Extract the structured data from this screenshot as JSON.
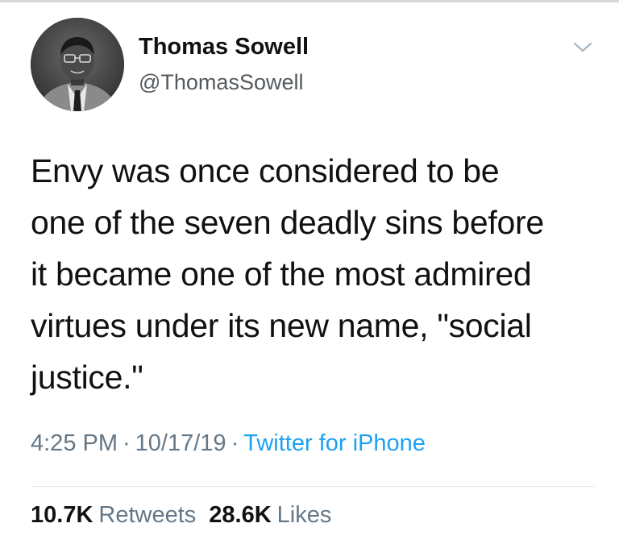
{
  "user": {
    "display_name": "Thomas Sowell",
    "handle": "@ThomasSowell",
    "avatar_icon": "profile-photo"
  },
  "tweet": {
    "text": "Envy was once considered to be\none of the seven deadly sins before\nit became one of the most admired\nvirtues under its new name, \"social\njustice.\""
  },
  "meta": {
    "time": "4:25 PM",
    "date": "10/17/19",
    "separator": "·",
    "source": "Twitter for iPhone"
  },
  "stats": {
    "retweets_count": "10.7K",
    "retweets_label": "Retweets",
    "likes_count": "28.6K",
    "likes_label": "Likes"
  },
  "colors": {
    "link": "#1da1f2",
    "muted": "#657786",
    "text": "#111111"
  }
}
